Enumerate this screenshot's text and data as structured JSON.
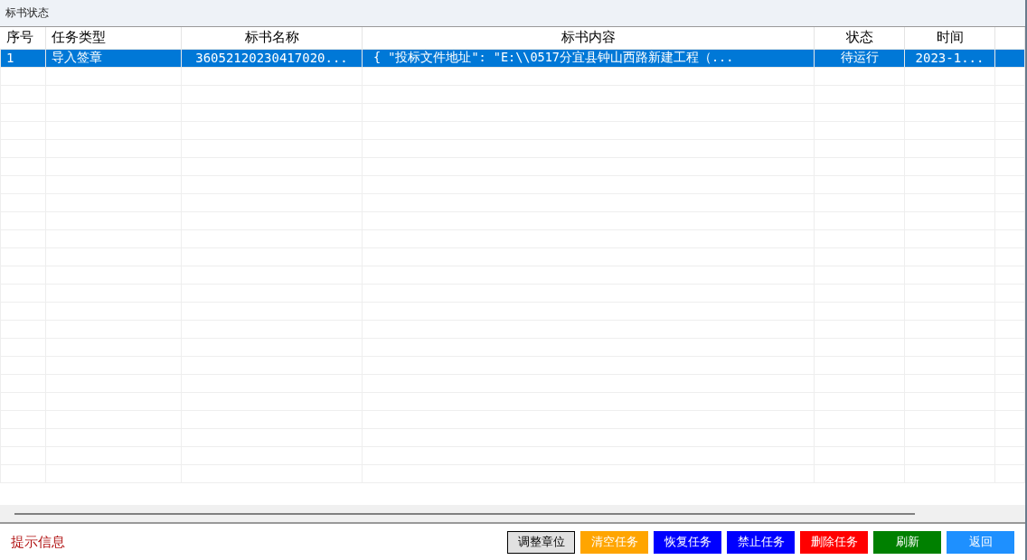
{
  "window": {
    "title": "标书状态"
  },
  "table": {
    "columns": [
      "序号",
      "任务类型",
      "标书名称",
      "标书内容",
      "状态",
      "时间"
    ],
    "rows": [
      {
        "selected": true,
        "cells": [
          "1",
          "导入签章",
          "36052120230417020...",
          "{  \"投标文件地址\": \"E:\\\\0517分宜县钟山西路新建工程（...",
          "待运行",
          "2023-1..."
        ]
      }
    ]
  },
  "status_message": "提示信息",
  "buttons": [
    {
      "label": "调整章位",
      "kind": "outlined",
      "color": "#e1e1e1"
    },
    {
      "label": "清空任务",
      "kind": "filled",
      "color": "#ffa500"
    },
    {
      "label": "恢复任务",
      "kind": "filled",
      "color": "#0000ff"
    },
    {
      "label": "禁止任务",
      "kind": "filled",
      "color": "#0000ff"
    },
    {
      "label": "删除任务",
      "kind": "filled",
      "color": "#ff0000"
    },
    {
      "label": "刷新",
      "kind": "filled",
      "color": "#008000"
    },
    {
      "label": "返回",
      "kind": "filled",
      "color": "#1e90ff"
    }
  ]
}
